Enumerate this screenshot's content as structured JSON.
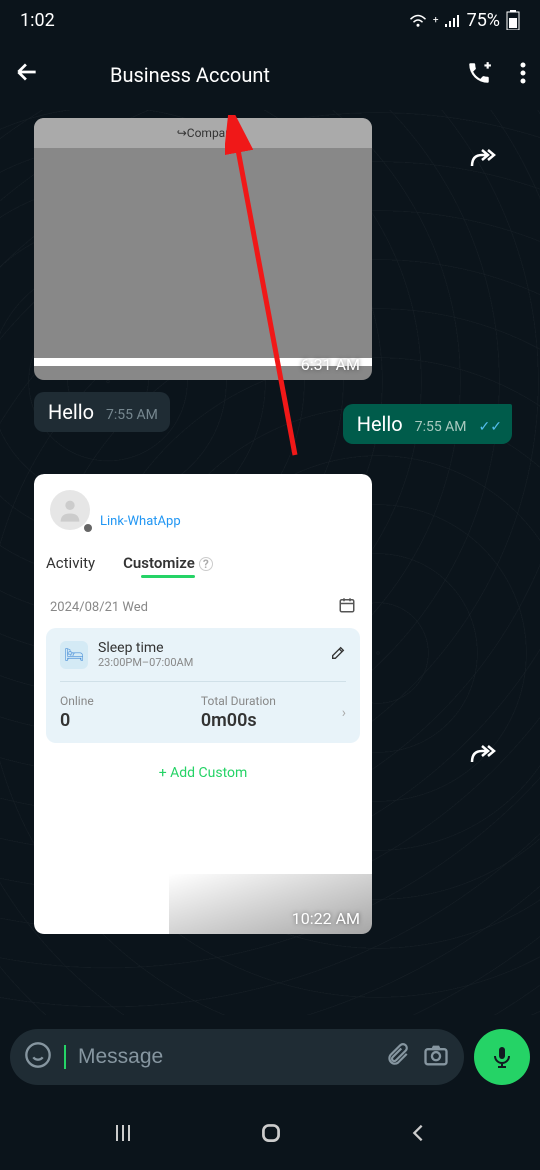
{
  "status": {
    "time": "1:02",
    "battery": "75%"
  },
  "header": {
    "title": "Business Account"
  },
  "preview_card": {
    "subtext": "Compar",
    "time": "6:31 AM"
  },
  "msg_in": {
    "text": "Hello",
    "time": "7:55 AM"
  },
  "msg_out": {
    "text": "Hello",
    "time": "7:55 AM"
  },
  "activity": {
    "link_label": "Link-WhatApp",
    "tab_activity": "Activity",
    "tab_customize": "Customize",
    "date": "2024/08/21 Wed",
    "sleep_title": "Sleep time",
    "sleep_range": "23:00PM–07:00AM",
    "online_label": "Online",
    "online_value": "0",
    "duration_label": "Total Duration",
    "duration_value": "0m00s",
    "add_custom": "+ Add Custom",
    "time": "10:22 AM"
  },
  "input": {
    "placeholder": "Message"
  }
}
